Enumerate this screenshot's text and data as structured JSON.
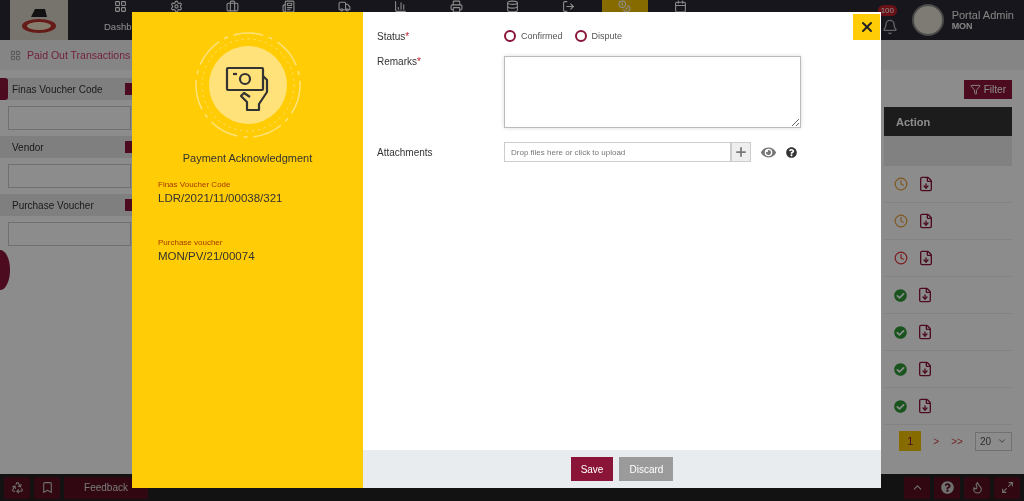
{
  "app_header": {
    "nav_items": [
      {
        "label": "Dashb",
        "selected": false
      },
      {
        "selected": false
      },
      {
        "selected": false
      },
      {
        "selected": false
      },
      {
        "selected": false
      },
      {
        "selected": false
      },
      {
        "selected": false
      },
      {
        "selected": false
      },
      {
        "selected": false
      },
      {
        "selected": true
      },
      {
        "selected": false
      }
    ],
    "notification_count": "100",
    "user_name": "Portal Admin",
    "user_branch": "MON"
  },
  "page_title": "Paid Out Transactions",
  "filters": [
    {
      "label": "Finas Voucher Code"
    },
    {
      "label": "Vendor"
    },
    {
      "label": "Purchase Voucher"
    }
  ],
  "filter_button": "Filter",
  "table": {
    "columns": [
      "Action"
    ],
    "rows": [
      {
        "kind": "pending"
      },
      {
        "kind": "pending"
      },
      {
        "kind": "overdue"
      },
      {
        "kind": "done"
      },
      {
        "kind": "done"
      },
      {
        "kind": "done"
      },
      {
        "kind": "done"
      }
    ]
  },
  "pagination": {
    "pages": [
      {
        "label": "1",
        "selected": true
      }
    ],
    "next": ">",
    "last": ">>",
    "page_size": "20"
  },
  "footer": {
    "feedback": "Feedback"
  },
  "modal": {
    "title": "Payment Acknowledgment",
    "details": [
      {
        "label": "Finas Voucher Code",
        "value": "LDR/2021/11/00038/321"
      },
      {
        "label": "Purchase voucher",
        "value": "MON/PV/21/00074"
      }
    ],
    "fields": [
      {
        "kind": "radio",
        "label": "Status",
        "required_mark": "*",
        "options": [
          {
            "label": "Confirmed",
            "selected": false
          },
          {
            "label": "Dispute",
            "selected": false
          }
        ]
      },
      {
        "kind": "textarea",
        "label": "Remarks",
        "required_mark": "*"
      },
      {
        "kind": "upload",
        "label": "Attachments",
        "placeholder": "Drop files here or click to upload"
      }
    ],
    "buttons": [
      {
        "label": "Save",
        "kind": "primary"
      },
      {
        "label": "Discard",
        "kind": "secondary"
      }
    ]
  }
}
